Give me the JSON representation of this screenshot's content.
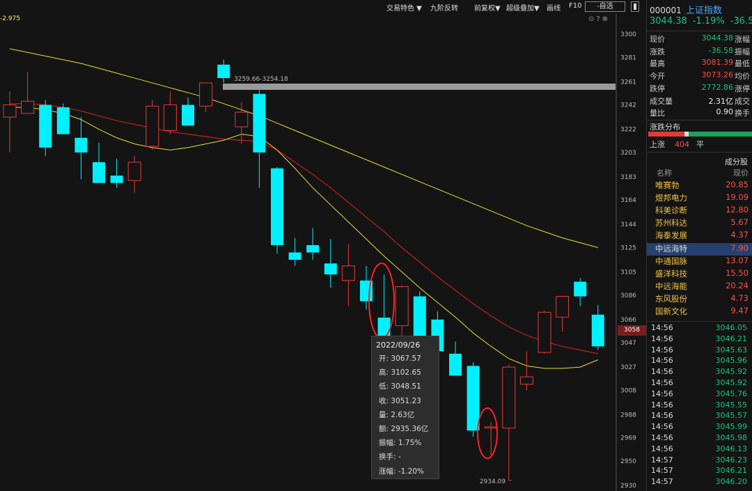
{
  "toolbar": {
    "items": [
      "交易特色 ▼",
      "九阶反转",
      "前复权▼",
      "超级叠加▼",
      "画线",
      "F10"
    ],
    "select": "-自选"
  },
  "ma_label": "-2.975",
  "annotations": {
    "zone_label": "3259.66-3254.18",
    "low_label": "2934.09",
    "current_price_tag": "3058"
  },
  "tooltip": {
    "date": "2022/09/26",
    "rows": [
      {
        "label": "开:",
        "value": "3067.57"
      },
      {
        "label": "高:",
        "value": "3102.65"
      },
      {
        "label": "低:",
        "value": "3048.51"
      },
      {
        "label": "收:",
        "value": "3051.23"
      },
      {
        "label": "量:",
        "value": "2.63亿"
      },
      {
        "label": "额:",
        "value": "2935.36亿"
      },
      {
        "label": "振幅:",
        "value": "1.75%"
      },
      {
        "label": "换手:",
        "value": "-"
      },
      {
        "label": "涨幅:",
        "value": "-1.20%"
      }
    ]
  },
  "chart_data": {
    "type": "candlestick",
    "ylim": [
      2930,
      3300
    ],
    "y_ticks": [
      3300,
      3281,
      3261,
      3242,
      3222,
      3203,
      3183,
      3164,
      3144,
      3125,
      3105,
      3086,
      3066,
      3047,
      3027,
      3008,
      2988,
      2969,
      2950,
      2930
    ],
    "candles": [
      {
        "o": 3232,
        "h": 3253,
        "l": 3203,
        "c": 3242
      },
      {
        "o": 3235,
        "h": 3269,
        "l": 3238,
        "c": 3245
      },
      {
        "o": 3242,
        "h": 3246,
        "l": 3200,
        "c": 3207
      },
      {
        "o": 3240,
        "h": 3243,
        "l": 3222,
        "c": 3218
      },
      {
        "o": 3215,
        "h": 3232,
        "l": 3181,
        "c": 3203
      },
      {
        "o": 3195,
        "h": 3211,
        "l": 3181,
        "c": 3178
      },
      {
        "o": 3184,
        "h": 3198,
        "l": 3174,
        "c": 3178
      },
      {
        "o": 3180,
        "h": 3200,
        "l": 3170,
        "c": 3195
      },
      {
        "o": 3208,
        "h": 3246,
        "l": 3205,
        "c": 3241
      },
      {
        "o": 3221,
        "h": 3253,
        "l": 3218,
        "c": 3242
      },
      {
        "o": 3242,
        "h": 3248,
        "l": 3228,
        "c": 3225
      },
      {
        "o": 3241,
        "h": 3258,
        "l": 3236,
        "c": 3260
      },
      {
        "o": 3275,
        "h": 3279,
        "l": 3260,
        "c": 3264
      },
      {
        "o": 3224,
        "h": 3244,
        "l": 3210,
        "c": 3236
      },
      {
        "o": 3251,
        "h": 3254,
        "l": 3174,
        "c": 3203
      },
      {
        "o": 3190,
        "h": 3191,
        "l": 3120,
        "c": 3127
      },
      {
        "o": 3121,
        "h": 3133,
        "l": 3110,
        "c": 3115
      },
      {
        "o": 3127,
        "h": 3141,
        "l": 3115,
        "c": 3121
      },
      {
        "o": 3112,
        "h": 3132,
        "l": 3092,
        "c": 3103
      },
      {
        "o": 3098,
        "h": 3128,
        "l": 3077,
        "c": 3110
      },
      {
        "o": 3098,
        "h": 3110,
        "l": 3074,
        "c": 3081
      },
      {
        "o": 3067.57,
        "h": 3102.65,
        "l": 3048.51,
        "c": 3051.23
      },
      {
        "o": 3061,
        "h": 3094,
        "l": 3050,
        "c": 3093
      },
      {
        "o": 3085,
        "h": 3089,
        "l": 3039,
        "c": 3041
      },
      {
        "o": 3066,
        "h": 3073,
        "l": 3032,
        "c": 3040
      },
      {
        "o": 3038,
        "h": 3048,
        "l": 3020,
        "c": 3020
      },
      {
        "o": 3028,
        "h": 3031,
        "l": 2970,
        "c": 2975
      },
      {
        "o": 2977,
        "h": 2982,
        "l": 2955,
        "c": 2978
      },
      {
        "o": 2977,
        "h": 3029,
        "l": 2934.09,
        "c": 3027
      },
      {
        "o": 3013,
        "h": 3040,
        "l": 3008,
        "c": 3019
      },
      {
        "o": 3039,
        "h": 3073,
        "l": 3038,
        "c": 3072
      },
      {
        "o": 3068,
        "h": 3078,
        "l": 3056,
        "c": 3085
      },
      {
        "o": 3097,
        "h": 3100,
        "l": 3077,
        "c": 3085
      },
      {
        "o": 3070,
        "h": 3078,
        "l": 3041,
        "c": 3044
      }
    ],
    "ma_short": [
      3240,
      3240,
      3238,
      3235,
      3230,
      3222,
      3215,
      3210,
      3207,
      3205,
      3207,
      3210,
      3213,
      3218,
      3216,
      3205,
      3190,
      3174,
      3160,
      3146,
      3132,
      3118,
      3105,
      3092,
      3080,
      3068,
      3055,
      3044,
      3034,
      3028,
      3026,
      3026,
      3027,
      3033
    ],
    "ma_mid": [
      3243,
      3243,
      3242,
      3240,
      3237,
      3233,
      3229,
      3226,
      3223,
      3220,
      3218,
      3216,
      3214,
      3213,
      3212,
      3205,
      3195,
      3185,
      3174,
      3162,
      3150,
      3138,
      3125,
      3113,
      3101,
      3090,
      3079,
      3069,
      3060,
      3053,
      3048,
      3044,
      3041,
      3038
    ],
    "ma_long": [
      3288,
      3285,
      3282,
      3279,
      3276,
      3272,
      3268,
      3264,
      3260,
      3256,
      3252,
      3248,
      3243,
      3238,
      3233,
      3227,
      3221,
      3215,
      3209,
      3203,
      3197,
      3191,
      3185,
      3179,
      3173,
      3167,
      3161,
      3155,
      3149,
      3143,
      3138,
      3133,
      3129,
      3125
    ],
    "colors": {
      "up": "#e03c3c",
      "down": "#00f0ff",
      "ma_short": "#e8e030",
      "ma_mid": "#c02020",
      "ma_long": "#e8e030"
    }
  },
  "panel": {
    "code": "000001",
    "name": "上证指数",
    "price": "3044.38",
    "change_pct": "-1.19%",
    "change": "-36.5",
    "quotes": [
      {
        "label": "现价",
        "value": "3044.38",
        "cls": "green",
        "label2": "涨幅"
      },
      {
        "label": "涨跌",
        "value": "-36.58",
        "cls": "green",
        "label2": "振幅"
      },
      {
        "label": "最高",
        "value": "3081.39",
        "cls": "red",
        "label2": "最低"
      },
      {
        "label": "今开",
        "value": "3073.26",
        "cls": "red",
        "label2": "均价"
      },
      {
        "label": "跌停",
        "value": "2772.86",
        "cls": "green",
        "label2": "涨停"
      },
      {
        "label": "成交量",
        "value": "2.31亿",
        "cls": "white",
        "label2": "成交"
      },
      {
        "label": "量比",
        "value": "0.90",
        "cls": "white",
        "label2": "换手"
      }
    ],
    "dist_title": "涨跌分布",
    "up_label": "上涨",
    "up_count": "404",
    "flat_label": "平",
    "comp_title": "成分股",
    "comp_head": {
      "name": "名称",
      "price": "现价"
    },
    "stocks": [
      {
        "name": "唯赛勃",
        "price": "20.85"
      },
      {
        "name": "煜邦电力",
        "price": "19.09"
      },
      {
        "name": "科美诊断",
        "price": "12.80"
      },
      {
        "name": "苏州科达",
        "price": "5.67"
      },
      {
        "name": "海泰发展",
        "price": "4.37"
      },
      {
        "name": "中远海特",
        "price": "7.90"
      },
      {
        "name": "中通国脉",
        "price": "13.07"
      },
      {
        "name": "盛洋科技",
        "price": "15.50"
      },
      {
        "name": "中远海能",
        "price": "20.24"
      },
      {
        "name": "东风股份",
        "price": "4.73"
      },
      {
        "name": "国新文化",
        "price": "9.47"
      }
    ],
    "selected_stock": "中远海特",
    "ticks": [
      {
        "time": "14:56",
        "price": "3046.05"
      },
      {
        "time": "14:56",
        "price": "3046.21"
      },
      {
        "time": "14:56",
        "price": "3045.63"
      },
      {
        "time": "14:56",
        "price": "3045.96"
      },
      {
        "time": "14:56",
        "price": "3045.92"
      },
      {
        "time": "14:56",
        "price": "3045.92"
      },
      {
        "time": "14:56",
        "price": "3045.76"
      },
      {
        "time": "14:56",
        "price": "3045.55"
      },
      {
        "time": "14:56",
        "price": "3045.57"
      },
      {
        "time": "14:56",
        "price": "3045.99"
      },
      {
        "time": "14:56",
        "price": "3045.98"
      },
      {
        "time": "14:56",
        "price": "3046.13"
      },
      {
        "time": "14:57",
        "price": "3046.23"
      },
      {
        "time": "14:57",
        "price": "3046.21"
      },
      {
        "time": "14:57",
        "price": "3046.20"
      }
    ]
  }
}
